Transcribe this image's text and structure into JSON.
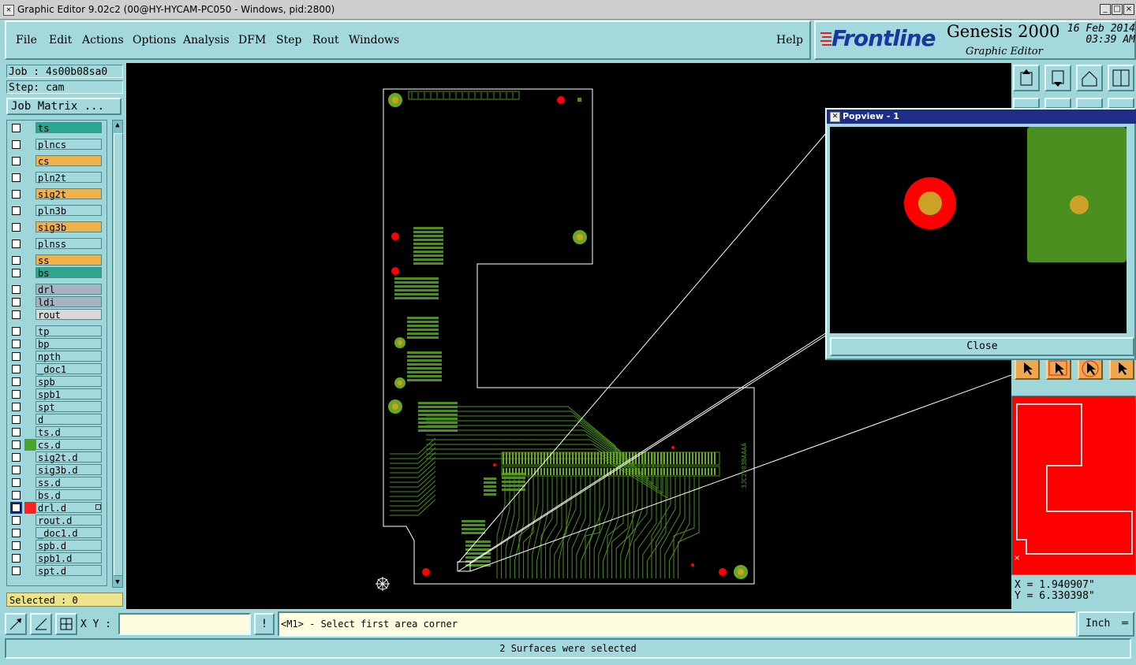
{
  "window": {
    "title": "Graphic Editor 9.02c2 (00@HY-HYCAM-PC050 - Windows, pid:2800)",
    "minimize": "_",
    "maximize": "□",
    "close": "×"
  },
  "menu": {
    "items": [
      "File",
      "Edit",
      "Actions",
      "Options",
      "Analysis",
      "DFM",
      "Step",
      "Rout",
      "Windows"
    ],
    "help": "Help"
  },
  "logo": {
    "brand": "Frontline",
    "product": "Genesis 2000",
    "subtitle": "Graphic Editor",
    "date": "16 Feb 2014",
    "time": "03:39 AM"
  },
  "left": {
    "job": "Job : 4s00b08sa0",
    "step": "Step: cam",
    "job_matrix": "Job Matrix ...",
    "selected": "Selected : 0",
    "layers": [
      {
        "name": "ts",
        "bg": "#2aa78e",
        "swatch": ""
      },
      {
        "name": "plncs",
        "bg": "#a3d9dd",
        "swatch": ""
      },
      {
        "name": "cs",
        "bg": "#f0b04a",
        "swatch": ""
      },
      {
        "name": "pln2t",
        "bg": "#a3d9dd",
        "swatch": ""
      },
      {
        "name": "sig2t",
        "bg": "#f0b04a",
        "swatch": ""
      },
      {
        "name": "pln3b",
        "bg": "#a3d9dd",
        "swatch": ""
      },
      {
        "name": "sig3b",
        "bg": "#f0b04a",
        "swatch": ""
      },
      {
        "name": "plnss",
        "bg": "#a3d9dd",
        "swatch": ""
      },
      {
        "name": "ss",
        "bg": "#f0b04a",
        "swatch": ""
      },
      {
        "name": "bs",
        "bg": "#2aa78e",
        "swatch": ""
      },
      {
        "name": "drl",
        "bg": "#a6b4c0",
        "swatch": ""
      },
      {
        "name": "ldi",
        "bg": "#a6b4c0",
        "swatch": ""
      },
      {
        "name": "rout",
        "bg": "#d8d8d8",
        "swatch": ""
      },
      {
        "name": "tp",
        "bg": "#a3d9dd",
        "swatch": ""
      },
      {
        "name": "bp",
        "bg": "#a3d9dd",
        "swatch": ""
      },
      {
        "name": "npth",
        "bg": "#a3d9dd",
        "swatch": ""
      },
      {
        "name": "_doc1",
        "bg": "#a3d9dd",
        "swatch": ""
      },
      {
        "name": "spb",
        "bg": "#a3d9dd",
        "swatch": ""
      },
      {
        "name": "spb1",
        "bg": "#a3d9dd",
        "swatch": ""
      },
      {
        "name": "spt",
        "bg": "#a3d9dd",
        "swatch": ""
      },
      {
        "name": "d",
        "bg": "#a3d9dd",
        "swatch": ""
      },
      {
        "name": "ts.d",
        "bg": "#a3d9dd",
        "swatch": ""
      },
      {
        "name": "cs.d",
        "bg": "#a3d9dd",
        "swatch": "#4aa52a"
      },
      {
        "name": "sig2t.d",
        "bg": "#a3d9dd",
        "swatch": ""
      },
      {
        "name": "sig3b.d",
        "bg": "#a3d9dd",
        "swatch": ""
      },
      {
        "name": "ss.d",
        "bg": "#a3d9dd",
        "swatch": ""
      },
      {
        "name": "bs.d",
        "bg": "#a3d9dd",
        "swatch": ""
      },
      {
        "name": "drl.d",
        "bg": "#a3d9dd",
        "swatch": "#ff2020",
        "active": true
      },
      {
        "name": "rout.d",
        "bg": "#a3d9dd",
        "swatch": ""
      },
      {
        "name": "_doc1.d",
        "bg": "#a3d9dd",
        "swatch": ""
      },
      {
        "name": "spb.d",
        "bg": "#a3d9dd",
        "swatch": ""
      },
      {
        "name": "spb1.d",
        "bg": "#a3d9dd",
        "swatch": ""
      },
      {
        "name": "spt.d",
        "bg": "#a3d9dd",
        "swatch": ""
      }
    ]
  },
  "canvas": {
    "board_marking": "3JC2903BAAAA"
  },
  "popview": {
    "title": "Popview - 1",
    "close_label": "Close"
  },
  "right": {
    "x_readout": "X = 1.940907\"",
    "y_readout": "Y = 6.330398\""
  },
  "bottom": {
    "xy_label": "X Y :",
    "xy_value": "",
    "excl": "!",
    "prompt": "<M1> - Select first area corner",
    "units": "Inch",
    "status": "2 Surfaces were selected"
  },
  "colors": {
    "panel": "#a3d9dd",
    "copper": "#4a8f1f",
    "pad": "#6aa820",
    "drill": "#ff0000",
    "drill_inner": "#c9a227",
    "outline": "#ffffff"
  }
}
